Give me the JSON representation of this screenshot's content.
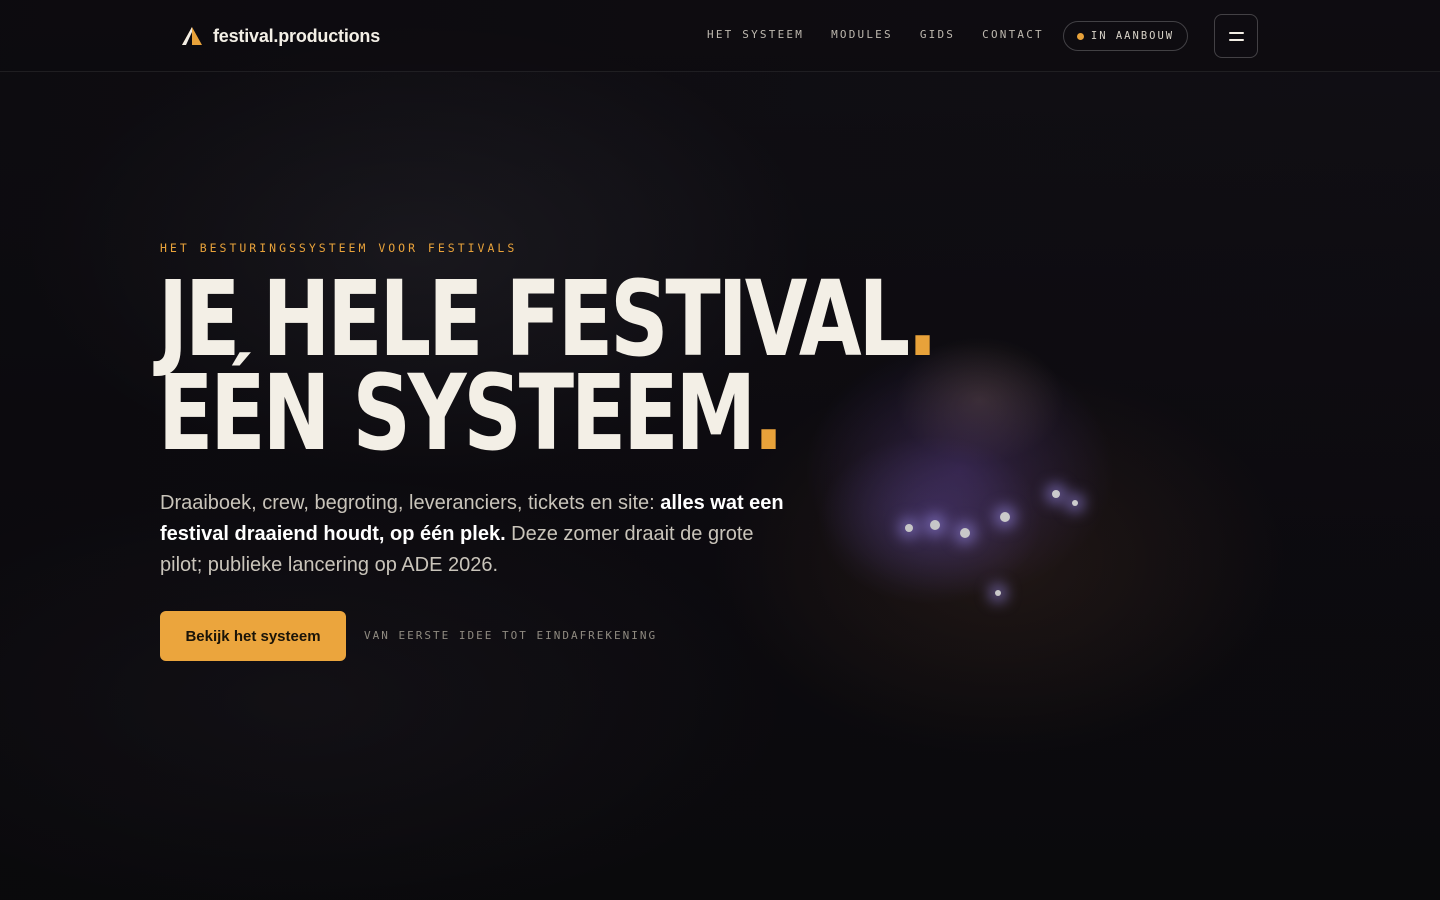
{
  "brand": {
    "name": "festival.productions",
    "icon": "triangle-logo-icon",
    "accent": "#e8a23a"
  },
  "nav": {
    "items": [
      "HET SYSTEEM",
      "MODULES",
      "GIDS",
      "CONTACT"
    ]
  },
  "status": {
    "label": "IN AANBOUW",
    "dot_color": "#e8a23a"
  },
  "menu": {
    "icon": "hamburger-menu-icon"
  },
  "hero": {
    "eyebrow": "HET BESTURINGSSYSTEEM VOOR FESTIVALS",
    "headline_line1": "JE HELE FESTIVAL",
    "headline_line2": "EÉN SYSTEEM",
    "headline_dot": ".",
    "lede_part1": "Draaiboek, crew, begroting, leveranciers, tickets en site: ",
    "lede_bold": "alles wat een festival draaiend houdt, op één plek.",
    "lede_part2": " Deze zomer draait de grote pilot; publieke lancering op ADE 2026.",
    "cta_label": "Bekijk het systeem",
    "cta_note": "VAN EERSTE IDEE TOT EINDAFREKENING"
  },
  "colors": {
    "background": "#0b0a0f",
    "text": "#f3efe6",
    "accent": "#e8a23a"
  }
}
